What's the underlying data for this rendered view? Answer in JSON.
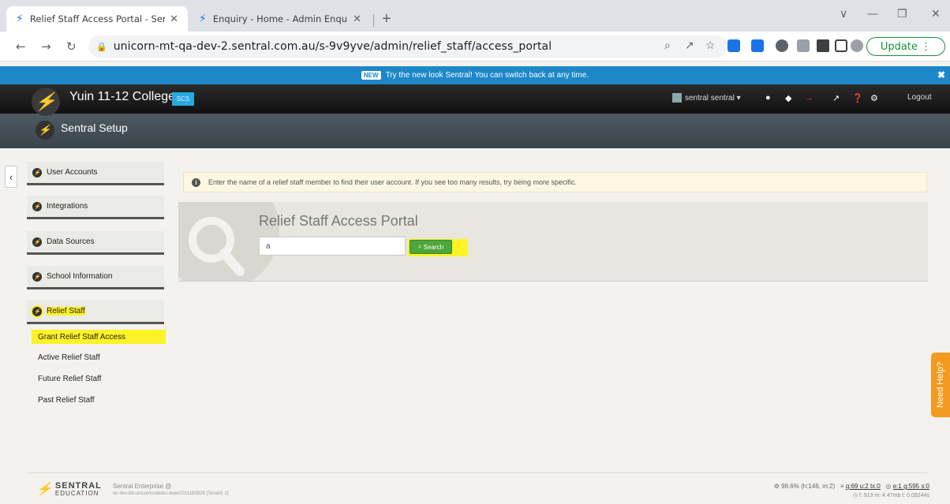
{
  "browser": {
    "tabs": [
      {
        "title": "Relief Staff Access Portal - Sentra",
        "active": true
      },
      {
        "title": "Enquiry - Home - Admin Enquiry",
        "active": false
      }
    ],
    "new_tab": "+",
    "url": "unicorn-mt-qa-dev-2.sentral.com.au/s-9v9yve/admin/relief_staff/access_portal",
    "update_label": "Update"
  },
  "announcement": {
    "badge": "NEW",
    "text": "Try the new look Sentral! You can switch back at any time."
  },
  "header": {
    "school": "Yuin 11-12 College",
    "school_badge": "SCS",
    "user": "sentral sentral",
    "logout": "Logout",
    "section": "Sentral Setup"
  },
  "sidebar": {
    "items": [
      {
        "label": "User Accounts"
      },
      {
        "label": "Integrations"
      },
      {
        "label": "Data Sources"
      },
      {
        "label": "School Information"
      },
      {
        "label": "Relief Staff"
      }
    ],
    "relief_links": [
      {
        "label": "Grant Relief Staff Access"
      },
      {
        "label": "Active Relief Staff"
      },
      {
        "label": "Future Relief Staff"
      },
      {
        "label": "Past Relief Staff"
      }
    ]
  },
  "info": {
    "text": "Enter the name of a relief staff member to find their user account. If you see too many results, try being more specific."
  },
  "portal": {
    "title": "Relief Staff Access Portal",
    "search_value": "a",
    "search_label": "Search"
  },
  "help": {
    "label": "Need Help?"
  },
  "footer": {
    "brand_top": "SENTRAL",
    "brand_bottom": "EDUCATION",
    "enterprise": "Sentral Enterprise @",
    "server": "on dev-bb-unicorncodetes-www2211180826 [Tenant: 2]",
    "stats_line1_a": "98.6%",
    "stats_line1_b": "(h:146, m:2)",
    "stats_line1_c": "q:69  u:2  tx:0",
    "stats_line1_d": "e:1  g:595  s:0",
    "stats_line2": "f: 513  m: 4.47mb  t: 0.09244s"
  }
}
